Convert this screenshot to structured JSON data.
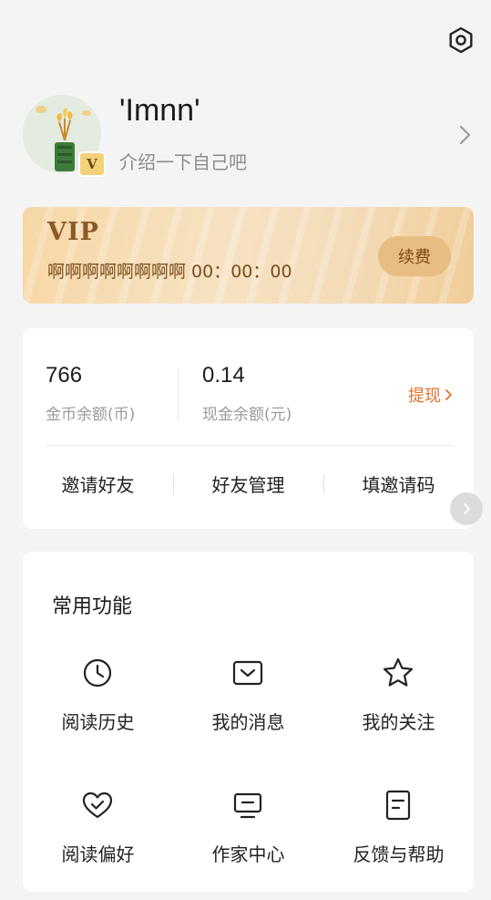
{
  "header": {
    "settings_icon": "gear-icon"
  },
  "profile": {
    "username": "'Imnn'",
    "bio": "介绍一下自己吧",
    "badge": "V"
  },
  "vip": {
    "title": "VIP",
    "description": "啊啊啊啊啊啊啊啊 00：00：00",
    "renew_label": "续费"
  },
  "wallet": {
    "coins_value": "766",
    "coins_label": "金币余额(币)",
    "cash_value": "0.14",
    "cash_label": "现金余额(元)",
    "withdraw_label": "提现",
    "actions": [
      "邀请好友",
      "好友管理",
      "填邀请码"
    ]
  },
  "functions": {
    "title": "常用功能",
    "items": [
      {
        "label": "阅读历史",
        "icon": "clock-icon"
      },
      {
        "label": "我的消息",
        "icon": "message-icon"
      },
      {
        "label": "我的关注",
        "icon": "star-icon"
      },
      {
        "label": "阅读偏好",
        "icon": "heart-check-icon"
      },
      {
        "label": "作家中心",
        "icon": "monitor-icon"
      },
      {
        "label": "反馈与帮助",
        "icon": "document-icon"
      }
    ]
  },
  "colors": {
    "accent": "#e0712e",
    "vip_text": "#8a5a28",
    "background": "#f4f4f4"
  }
}
